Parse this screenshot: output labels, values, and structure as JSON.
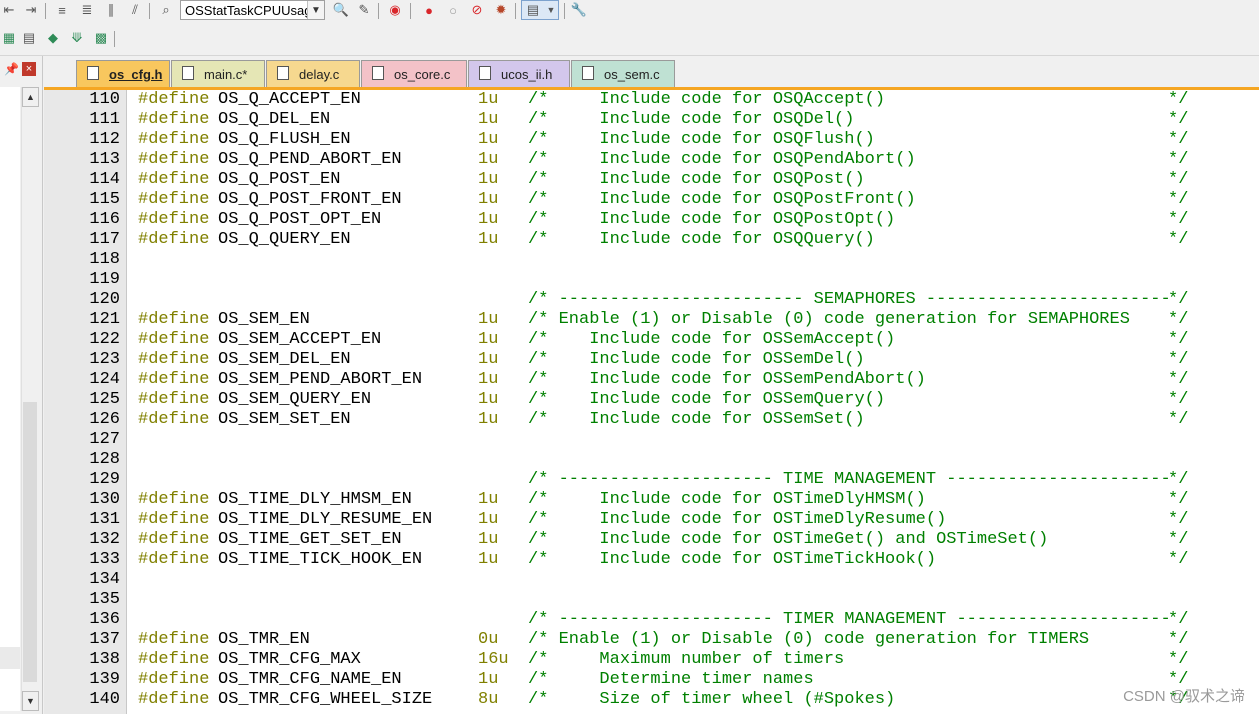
{
  "toolbar": {
    "function_combo_value": "OSStatTaskCPUUsag",
    "colors": {
      "record": "#d9262b",
      "build_accent": "#2e8b57"
    }
  },
  "tabs": [
    {
      "label": "os_cfg.h",
      "color": "#f8c75e",
      "active": true
    },
    {
      "label": "main.c*",
      "color": "#e5e6b5",
      "active": false
    },
    {
      "label": "delay.c",
      "color": "#f6d88f",
      "active": false
    },
    {
      "label": "os_core.c",
      "color": "#f3c2c8",
      "active": false
    },
    {
      "label": "ucos_ii.h",
      "color": "#d3c7ec",
      "active": false
    },
    {
      "label": "os_sem.c",
      "color": "#bfe1d3",
      "active": false
    }
  ],
  "editor": {
    "lines": [
      {
        "n": "110",
        "d": "#define",
        "m": "OS_Q_ACCEPT_EN",
        "v": "1u",
        "c": "/*     Include code for OSQAccept()",
        "e": "*/"
      },
      {
        "n": "111",
        "d": "#define",
        "m": "OS_Q_DEL_EN",
        "v": "1u",
        "c": "/*     Include code for OSQDel()",
        "e": "*/"
      },
      {
        "n": "112",
        "d": "#define",
        "m": "OS_Q_FLUSH_EN",
        "v": "1u",
        "c": "/*     Include code for OSQFlush()",
        "e": "*/"
      },
      {
        "n": "113",
        "d": "#define",
        "m": "OS_Q_PEND_ABORT_EN",
        "v": "1u",
        "c": "/*     Include code for OSQPendAbort()",
        "e": "*/"
      },
      {
        "n": "114",
        "d": "#define",
        "m": "OS_Q_POST_EN",
        "v": "1u",
        "c": "/*     Include code for OSQPost()",
        "e": "*/"
      },
      {
        "n": "115",
        "d": "#define",
        "m": "OS_Q_POST_FRONT_EN",
        "v": "1u",
        "c": "/*     Include code for OSQPostFront()",
        "e": "*/"
      },
      {
        "n": "116",
        "d": "#define",
        "m": "OS_Q_POST_OPT_EN",
        "v": "1u",
        "c": "/*     Include code for OSQPostOpt()",
        "e": "*/"
      },
      {
        "n": "117",
        "d": "#define",
        "m": "OS_Q_QUERY_EN",
        "v": "1u",
        "c": "/*     Include code for OSQQuery()",
        "e": "*/"
      },
      {
        "n": "118",
        "d": "",
        "m": "",
        "v": "",
        "c": "",
        "e": ""
      },
      {
        "n": "119",
        "d": "",
        "m": "",
        "v": "",
        "c": "",
        "e": ""
      },
      {
        "n": "120",
        "d": "",
        "m": "",
        "v": "",
        "c": "/* ------------------------ SEMAPHORES ------------------------",
        "e": "*/"
      },
      {
        "n": "121",
        "d": "#define",
        "m": "OS_SEM_EN",
        "v": "1u",
        "c": "/* Enable (1) or Disable (0) code generation for SEMAPHORES",
        "e": "*/"
      },
      {
        "n": "122",
        "d": "#define",
        "m": "OS_SEM_ACCEPT_EN",
        "v": "1u",
        "c": "/*    Include code for OSSemAccept()",
        "e": "*/"
      },
      {
        "n": "123",
        "d": "#define",
        "m": "OS_SEM_DEL_EN",
        "v": "1u",
        "c": "/*    Include code for OSSemDel()",
        "e": "*/"
      },
      {
        "n": "124",
        "d": "#define",
        "m": "OS_SEM_PEND_ABORT_EN",
        "v": "1u",
        "c": "/*    Include code for OSSemPendAbort()",
        "e": "*/"
      },
      {
        "n": "125",
        "d": "#define",
        "m": "OS_SEM_QUERY_EN",
        "v": "1u",
        "c": "/*    Include code for OSSemQuery()",
        "e": "*/"
      },
      {
        "n": "126",
        "d": "#define",
        "m": "OS_SEM_SET_EN",
        "v": "1u",
        "c": "/*    Include code for OSSemSet()",
        "e": "*/"
      },
      {
        "n": "127",
        "d": "",
        "m": "",
        "v": "",
        "c": "",
        "e": ""
      },
      {
        "n": "128",
        "d": "",
        "m": "",
        "v": "",
        "c": "",
        "e": ""
      },
      {
        "n": "129",
        "d": "",
        "m": "",
        "v": "",
        "c": "/* --------------------- TIME MANAGEMENT ----------------------",
        "e": "*/"
      },
      {
        "n": "130",
        "d": "#define",
        "m": "OS_TIME_DLY_HMSM_EN",
        "v": "1u",
        "c": "/*     Include code for OSTimeDlyHMSM()",
        "e": "*/"
      },
      {
        "n": "131",
        "d": "#define",
        "m": "OS_TIME_DLY_RESUME_EN",
        "v": "1u",
        "c": "/*     Include code for OSTimeDlyResume()",
        "e": "*/"
      },
      {
        "n": "132",
        "d": "#define",
        "m": "OS_TIME_GET_SET_EN",
        "v": "1u",
        "c": "/*     Include code for OSTimeGet() and OSTimeSet()",
        "e": "*/"
      },
      {
        "n": "133",
        "d": "#define",
        "m": "OS_TIME_TICK_HOOK_EN",
        "v": "1u",
        "c": "/*     Include code for OSTimeTickHook()",
        "e": "*/"
      },
      {
        "n": "134",
        "d": "",
        "m": "",
        "v": "",
        "c": "",
        "e": ""
      },
      {
        "n": "135",
        "d": "",
        "m": "",
        "v": "",
        "c": "",
        "e": ""
      },
      {
        "n": "136",
        "d": "",
        "m": "",
        "v": "",
        "c": "/* --------------------- TIMER MANAGEMENT ---------------------",
        "e": "*/"
      },
      {
        "n": "137",
        "d": "#define",
        "m": "OS_TMR_EN",
        "v": "0u",
        "c": "/* Enable (1) or Disable (0) code generation for TIMERS",
        "e": "*/"
      },
      {
        "n": "138",
        "d": "#define",
        "m": "OS_TMR_CFG_MAX",
        "v": "16u",
        "c": "/*     Maximum number of timers",
        "e": "*/"
      },
      {
        "n": "139",
        "d": "#define",
        "m": "OS_TMR_CFG_NAME_EN",
        "v": "1u",
        "c": "/*     Determine timer names",
        "e": "*/"
      },
      {
        "n": "140",
        "d": "#define",
        "m": "OS_TMR_CFG_WHEEL_SIZE",
        "v": "8u",
        "c": "/*     Size of timer wheel (#Spokes)",
        "e": "*/"
      }
    ]
  },
  "watermark": "CSDN @驭术之谛"
}
